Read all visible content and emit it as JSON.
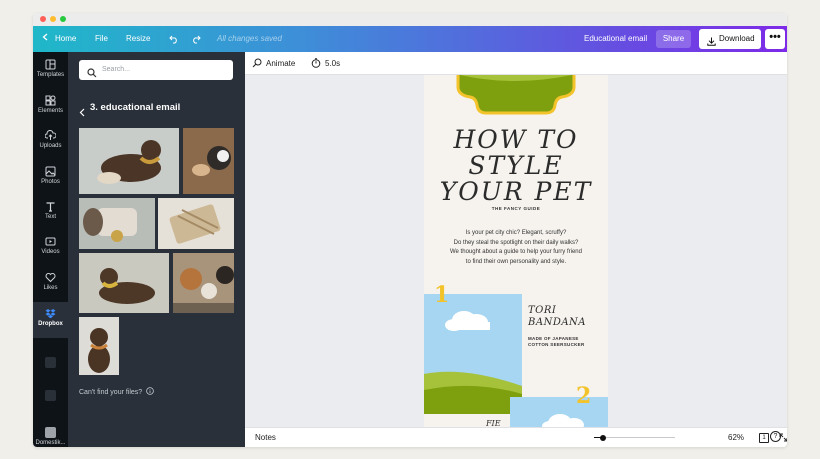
{
  "topbar": {
    "home": "Home",
    "file": "File",
    "resize": "Resize",
    "save_status": "All changes saved",
    "doc_title": "Educational email",
    "share": "Share",
    "download": "Download",
    "more": "•••"
  },
  "sidebar": {
    "items": [
      {
        "label": "Templates",
        "icon": "templates-icon"
      },
      {
        "label": "Elements",
        "icon": "elements-icon"
      },
      {
        "label": "Uploads",
        "icon": "uploads-icon"
      },
      {
        "label": "Photos",
        "icon": "photos-icon"
      },
      {
        "label": "Text",
        "icon": "text-icon"
      },
      {
        "label": "Videos",
        "icon": "videos-icon"
      },
      {
        "label": "Likes",
        "icon": "heart-icon"
      },
      {
        "label": "Dropbox",
        "icon": "dropbox-icon"
      },
      {
        "label": "Domestik...",
        "icon": "app-thumbnail"
      }
    ]
  },
  "panel": {
    "search_placeholder": "Search...",
    "folder_title": "3. educational email",
    "cant_find": "Can't find your files?",
    "photos": [
      {
        "name": "brown dog with golden scarf"
      },
      {
        "name": "dog eating treat"
      },
      {
        "name": "dog harness closeup"
      },
      {
        "name": "woven dog toy"
      },
      {
        "name": "lying dog with yellow scarf"
      },
      {
        "name": "poodle, cat and shiba"
      },
      {
        "name": "dog with collar"
      }
    ]
  },
  "toolbar": {
    "animate": "Animate",
    "duration": "5.0s"
  },
  "design": {
    "title_lines": [
      "HOW TO",
      "STYLE",
      "YOUR PET"
    ],
    "subtitle": "THE FANCY GUIDE",
    "body_lines": [
      "Is your pet city chic? Elegant, scruffy?",
      "Do they steal the spotlight on their daily walks?",
      "We thought about a guide to help your furry friend",
      "to find their own personality and style."
    ],
    "number_one": "1",
    "number_two": "2",
    "item_name_lines": [
      "TORI",
      "BANDANA"
    ],
    "item_desc_lines": [
      "MADE OF JAPANESE",
      "COTTON SEERSUCKER"
    ],
    "bottom_peek": "FIE"
  },
  "bottombar": {
    "notes": "Notes",
    "zoom_level": 62,
    "zoom_label": "62%",
    "page_count": "1",
    "help": "?"
  },
  "colors": {
    "gradient_start": "#1fb8c9",
    "gradient_end": "#7d2ae8",
    "rail_bg": "#0e1318",
    "panel_bg": "#293039",
    "accent_yellow": "#f3c32b",
    "hill_green": "#7fa00e",
    "sky_blue": "#a7d6f2"
  }
}
